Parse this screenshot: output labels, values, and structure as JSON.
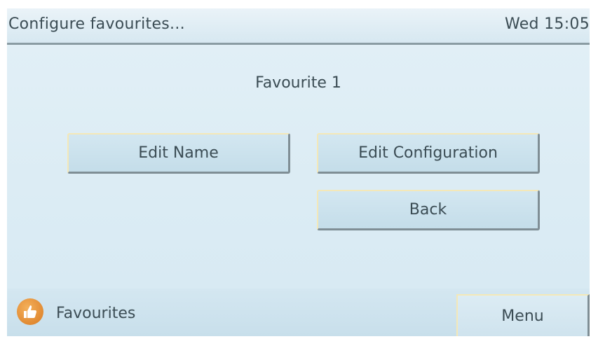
{
  "header": {
    "title": "Configure favourites...",
    "clock": "Wed 15:05"
  },
  "main": {
    "page_title": "Favourite 1",
    "buttons": {
      "edit_name": "Edit Name",
      "edit_configuration": "Edit Configuration",
      "back": "Back"
    }
  },
  "footer": {
    "favourites_label": "Favourites",
    "favourites_icon": "thumbs-up-icon",
    "menu_label": "Menu"
  },
  "colors": {
    "screen_background": "#dcecf4",
    "text": "#3b4c54",
    "icon_orange": "#e68a2e"
  }
}
